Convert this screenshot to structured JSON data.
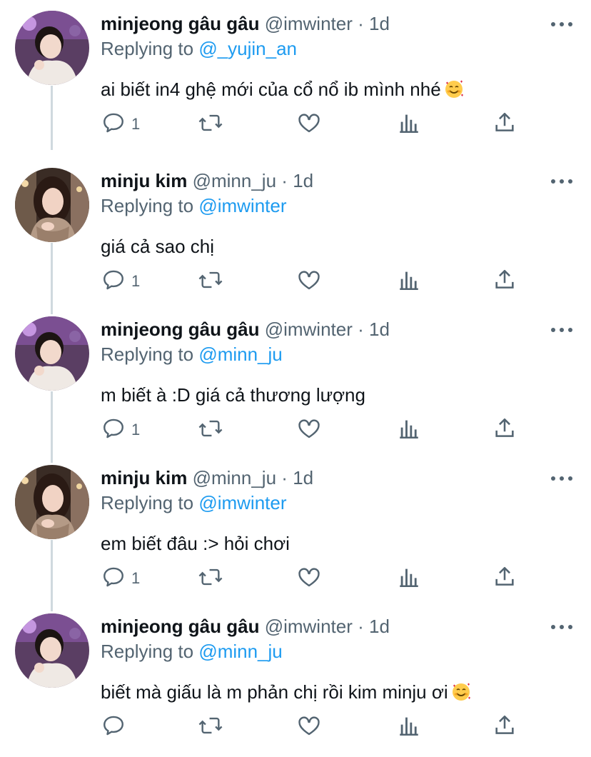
{
  "colors": {
    "text": "#0f1419",
    "secondary": "#536471",
    "accent": "#1d9bf0",
    "thread_line": "#cfd9de"
  },
  "tweets": [
    {
      "name": "minjeong gâu gâu",
      "handle": "@imwinter",
      "dot": "·",
      "time": "1d",
      "replying_prefix": "Replying to",
      "replying_to": "@_yujin_an",
      "text": "ai biết in4 ghệ mới của cổ nổ ib mình nhé",
      "emoji": "smiling-face-with-hearts",
      "reply_count": "1",
      "avatar": "baby-photo"
    },
    {
      "name": "minju kim",
      "handle": "@minn_ju",
      "dot": "·",
      "time": "1d",
      "replying_prefix": "Replying to",
      "replying_to": "@imwinter",
      "text": "giá cả sao chị",
      "emoji": "",
      "reply_count": "1",
      "avatar": "woman-photo"
    },
    {
      "name": "minjeong gâu gâu",
      "handle": "@imwinter",
      "dot": "·",
      "time": "1d",
      "replying_prefix": "Replying to",
      "replying_to": "@minn_ju",
      "text": "m biết à :D giá cả thương lượng",
      "emoji": "",
      "reply_count": "1",
      "avatar": "baby-photo"
    },
    {
      "name": "minju kim",
      "handle": "@minn_ju",
      "dot": "·",
      "time": "1d",
      "replying_prefix": "Replying to",
      "replying_to": "@imwinter",
      "text": "em biết đâu :> hỏi chơi",
      "emoji": "",
      "reply_count": "1",
      "avatar": "woman-photo"
    },
    {
      "name": "minjeong gâu gâu",
      "handle": "@imwinter",
      "dot": "·",
      "time": "1d",
      "replying_prefix": "Replying to",
      "replying_to": "@minn_ju",
      "text": "biết mà giấu là m phản chị rồi kim minju ơi",
      "emoji": "smiling-face-with-hearts",
      "reply_count": "",
      "avatar": "baby-photo"
    }
  ]
}
